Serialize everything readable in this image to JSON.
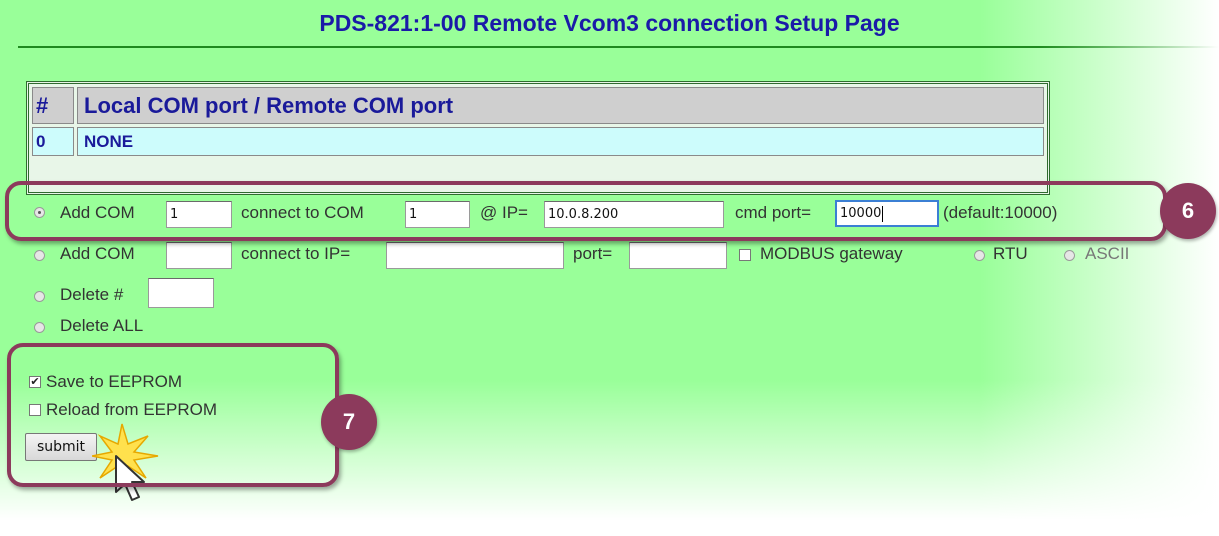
{
  "page": {
    "title": "PDS-821:1-00 Remote Vcom3 connection Setup Page"
  },
  "port_table": {
    "headers": [
      "#",
      "Local COM port / Remote COM port"
    ],
    "rows": [
      {
        "num": "0",
        "desc": "NONE"
      }
    ]
  },
  "add_com_row": {
    "label": "Add COM",
    "com_value": "1",
    "connect_label": "connect to COM",
    "remote_com_value": "1",
    "ip_label": "@ IP=",
    "ip_value": "10.0.8.200",
    "cmd_port_label": "cmd port=",
    "cmd_port_value": "10000",
    "default_note": "(default:10000)"
  },
  "add_com_ip_row": {
    "label": "Add COM",
    "connect_label": "connect to IP=",
    "port_label": "port=",
    "modbus_label": "MODBUS gateway",
    "rtu_label": "RTU",
    "ascii_label": "ASCII"
  },
  "delete_row": {
    "label": "Delete #"
  },
  "delete_all_row": {
    "label": "Delete ALL"
  },
  "options": {
    "save_label": "Save to EEPROM",
    "save_checked": true,
    "reload_label": "Reload from EEPROM",
    "reload_checked": false
  },
  "submit_label": "submit",
  "callouts": {
    "step6": "6",
    "step7": "7"
  },
  "colors": {
    "page_bg": "#99ff99",
    "title": "#1a1aa8",
    "callout": "#8c3a5c",
    "data_row_bg": "#cdfcfc"
  }
}
